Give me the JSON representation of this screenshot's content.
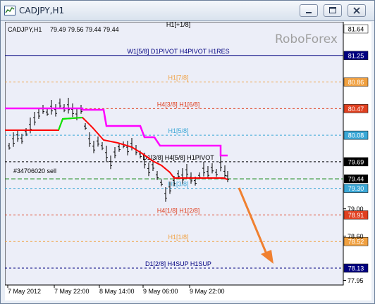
{
  "window": {
    "title": "CADJPY,H1",
    "icon": "chart-window-icon",
    "buttons": [
      "minimize-icon",
      "maximize-icon",
      "close-icon"
    ]
  },
  "chart_header": {
    "symbol": "CADJPY,H1",
    "ohlc": "79.49 79.56 79.44 79.44"
  },
  "watermark": "RoboForex",
  "order_label": "#34706020 sell",
  "colors": {
    "chart_bg": "#eceef8",
    "price_up": "#000000",
    "magenta_line": "#ff00ff",
    "red_line": "#ff0000",
    "green_line": "#00ee00",
    "arrow": "#f08030",
    "bid_line": "#008000"
  },
  "levels": [
    {
      "label": "H1[+1/8]",
      "price": "81.64",
      "value": 81.64,
      "line_color": "#000000",
      "tag_bg": "#ffffff",
      "tag_fg": "#000000",
      "style": "none"
    },
    {
      "label": "W1[5/8] D1PIVOT H4PIVOT H1RES",
      "price": "81.25",
      "value": 81.25,
      "line_color": "#000080",
      "tag_bg": "#000080",
      "tag_fg": "#ffffff",
      "style": "solid"
    },
    {
      "label": "H1[7/8]",
      "price": "80.86",
      "value": 80.86,
      "line_color": "#f0a040",
      "tag_bg": "#f0a040",
      "tag_fg": "#ffffff",
      "style": "dash"
    },
    {
      "label": "H4[3/8] H1[6/8]",
      "price": "80.47",
      "value": 80.47,
      "line_color": "#e04020",
      "tag_bg": "#e04020",
      "tag_fg": "#ffffff",
      "style": "dash"
    },
    {
      "label": "H1[5/8]",
      "price": "80.08",
      "value": 80.08,
      "line_color": "#3aa7d6",
      "tag_bg": "#3aa7d6",
      "tag_fg": "#ffffff",
      "style": "dash"
    },
    {
      "label": "D1[3/8] H4[5/8] H1PIVOT",
      "price": "79.69",
      "value": 79.69,
      "line_color": "#000000",
      "tag_bg": "#000000",
      "tag_fg": "#ffffff",
      "style": "dash"
    },
    {
      "label": "H1[3/8]",
      "price": "79.30",
      "value": 79.3,
      "line_color": "#3aa7d6",
      "tag_bg": "#3aa7d6",
      "tag_fg": "#ffffff",
      "style": "dash"
    },
    {
      "label": "H4[1/8] H1[2/8]",
      "price": "78.91",
      "value": 78.91,
      "line_color": "#e04020",
      "tag_bg": "#e04020",
      "tag_fg": "#ffffff",
      "style": "dash"
    },
    {
      "label": "H1[1/8]",
      "price": "78.52",
      "value": 78.52,
      "line_color": "#f0a040",
      "tag_bg": "#f0a040",
      "tag_fg": "#ffffff",
      "style": "dash"
    },
    {
      "label": "D1[2/8] H4SUP H1SUP",
      "price": "78.13",
      "value": 78.13,
      "line_color": "#000080",
      "tag_bg": "#000080",
      "tag_fg": "#ffffff",
      "style": "dash"
    }
  ],
  "current_price": {
    "label": "79.44",
    "value": 79.44
  },
  "axis_ticks": [
    {
      "label": "79.00",
      "value": 79.0
    },
    {
      "label": "78.60",
      "value": 78.6
    },
    {
      "label": "77.95",
      "value": 77.95
    }
  ],
  "time_labels": [
    "7 May 2012",
    "7 May 22:00",
    "8 May 14:00",
    "9 May 06:00",
    "9 May 22:00"
  ]
}
